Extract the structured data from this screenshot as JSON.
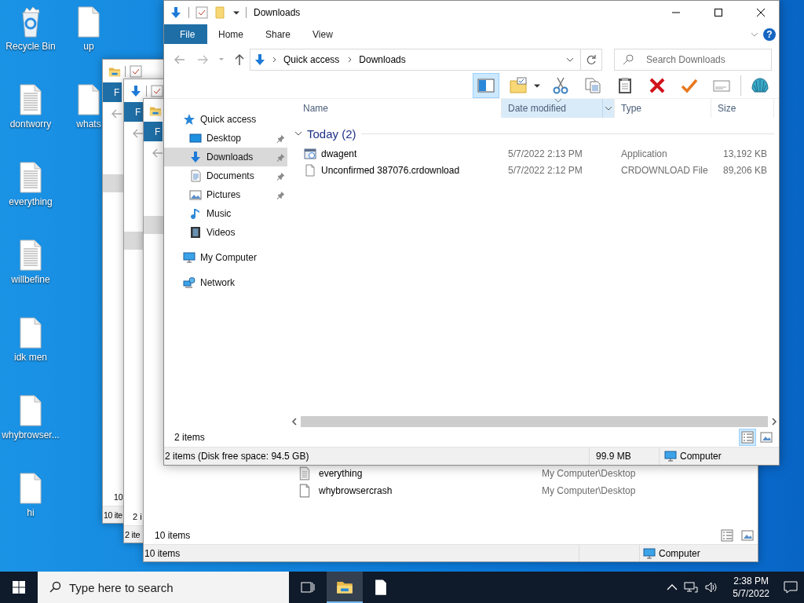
{
  "desktop_icons": [
    {
      "label": "Recycle Bin",
      "kind": "recycle-bin"
    },
    {
      "label": "dontworry",
      "kind": "text-file"
    },
    {
      "label": "everything",
      "kind": "text-file"
    },
    {
      "label": "willbefine",
      "kind": "text-file"
    },
    {
      "label": "idk men",
      "kind": "blank-file"
    },
    {
      "label": "whybrowser...",
      "kind": "blank-file"
    },
    {
      "label": "hi",
      "kind": "blank-file"
    },
    {
      "label": "up",
      "kind": "blank-file"
    },
    {
      "label": "whats",
      "kind": "blank-file"
    }
  ],
  "background_windows": [
    {
      "kind": "folder",
      "file_tab": "F",
      "item_count": "10",
      "status": "10 ite"
    },
    {
      "kind": "download",
      "file_tab": "F",
      "item_count": "2 i",
      "status": "2 ite"
    },
    {
      "kind": "folder",
      "file_tab": "F",
      "rows": [
        {
          "name": "everything",
          "location": "My Computer\\Desktop",
          "kind": "text-file"
        },
        {
          "name": "whybrowsercrash",
          "location": "My Computer\\Desktop",
          "kind": "blank-file"
        }
      ],
      "item_count": "10 items",
      "views": [
        {
          "kind": "details",
          "selected": false
        },
        {
          "kind": "large-icons",
          "selected": false
        }
      ],
      "status": "10 items",
      "status_location": "Computer"
    }
  ],
  "explorer": {
    "title": "Downloads",
    "ribbon_tabs": [
      {
        "label": "File",
        "selected": true
      },
      {
        "label": "Home",
        "selected": false
      },
      {
        "label": "Share",
        "selected": false
      },
      {
        "label": "View",
        "selected": false
      }
    ],
    "help_button": "?",
    "address": [
      "Quick access",
      "Downloads"
    ],
    "search": {
      "placeholder": "Search Downloads"
    },
    "toolbar": [
      {
        "kind": "preview-pane",
        "selected": true
      },
      {
        "kind": "new-folder",
        "selected": false
      },
      {
        "kind": "cut",
        "selected": false
      },
      {
        "kind": "copy",
        "selected": false
      },
      {
        "kind": "paste",
        "selected": false
      },
      {
        "kind": "delete",
        "selected": false
      },
      {
        "kind": "apply",
        "selected": false
      },
      {
        "kind": "rename",
        "selected": false
      },
      {
        "kind": "shell",
        "selected": false
      }
    ],
    "nav": [
      {
        "label": "Quick access",
        "kind": "star",
        "pinned": false,
        "selected": false,
        "children": [
          {
            "label": "Desktop",
            "kind": "desktop",
            "pinned": true,
            "selected": false
          },
          {
            "label": "Downloads",
            "kind": "download",
            "pinned": true,
            "selected": true
          },
          {
            "label": "Documents",
            "kind": "documents",
            "pinned": true,
            "selected": false
          },
          {
            "label": "Pictures",
            "kind": "pictures",
            "pinned": true,
            "selected": false
          },
          {
            "label": "Music",
            "kind": "music",
            "pinned": false,
            "selected": false
          },
          {
            "label": "Videos",
            "kind": "videos",
            "pinned": false,
            "selected": false
          }
        ]
      },
      {
        "label": "My Computer",
        "kind": "computer",
        "pinned": false,
        "selected": false
      },
      {
        "label": "Network",
        "kind": "network",
        "pinned": false,
        "selected": false
      }
    ],
    "columns": [
      {
        "label": "Name",
        "sorted": false
      },
      {
        "label": "Date modified",
        "sorted": true
      },
      {
        "label": "Type",
        "sorted": false
      },
      {
        "label": "Size",
        "sorted": false
      }
    ],
    "groups": [
      {
        "label": "Today (2)",
        "expanded": true,
        "rows": [
          {
            "name": "dwagent",
            "kind": "app",
            "date": "5/7/2022 2:13 PM",
            "type": "Application",
            "size": "13,192 KB"
          },
          {
            "name": "Unconfirmed 387076.crdownload",
            "kind": "blank-file",
            "date": "5/7/2022 2:12 PM",
            "type": "CRDOWNLOAD File",
            "size": "89,206 KB"
          }
        ]
      }
    ],
    "item_count": "2 items",
    "views": [
      {
        "kind": "details",
        "selected": true
      },
      {
        "kind": "large-icons",
        "selected": false
      }
    ],
    "status_bar": {
      "summary": "2 items (Disk free space: 94.5 GB)",
      "size": "99.9 MB",
      "location": "Computer"
    }
  },
  "taskbar": {
    "search": {
      "placeholder": "Type here to search"
    },
    "apps": [
      {
        "kind": "explorer",
        "active": true
      },
      {
        "kind": "notepad",
        "active": false
      }
    ],
    "time": "2:38 PM",
    "date": "5/7/2022"
  }
}
